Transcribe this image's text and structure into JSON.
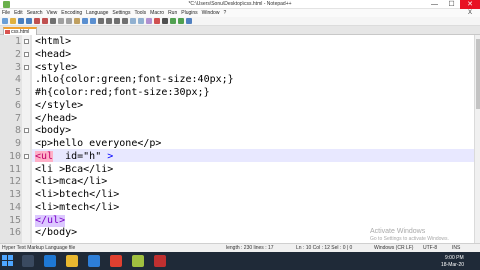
{
  "window": {
    "title": "*C:\\Users\\Sonu\\Desktop\\css.html - Notepad++",
    "controls": [
      "—",
      "☐",
      "✕"
    ]
  },
  "menu": [
    "File",
    "Edit",
    "Search",
    "View",
    "Encoding",
    "Language",
    "Settings",
    "Tools",
    "Macro",
    "Run",
    "Plugins",
    "Window",
    "?"
  ],
  "menu_close": "X",
  "tab": {
    "label": "css.html"
  },
  "editor": {
    "current_line": 10,
    "lines": [
      {
        "n": "1",
        "t": "<html>"
      },
      {
        "n": "2",
        "t": "<head>"
      },
      {
        "n": "3",
        "t": "<style>"
      },
      {
        "n": "4",
        "t": ".hlo{color:green;font-size:40px;}"
      },
      {
        "n": "5",
        "t": "#h{color:red;font-size:30px;}"
      },
      {
        "n": "6",
        "t": "</style>"
      },
      {
        "n": "7",
        "t": "</head>"
      },
      {
        "n": "8",
        "t": "<body>"
      },
      {
        "n": "9",
        "t": "<p>hello everyone</p>"
      },
      {
        "n": "10",
        "a": "<ul",
        "b": "  id=\"h\"",
        "c": " >"
      },
      {
        "n": "11",
        "t": "<li >Bca</li>"
      },
      {
        "n": "12",
        "t": "<li>mca</li>"
      },
      {
        "n": "13",
        "t": "<li>btech</li>"
      },
      {
        "n": "14",
        "t": "<li>mtech</li>"
      },
      {
        "n": "15",
        "t": "</ul>"
      },
      {
        "n": "16",
        "t": "</body>"
      }
    ]
  },
  "status": {
    "type": "Hyper Text Markup Language file",
    "length": "length : 230   lines : 17",
    "pos": "Ln : 10   Col : 12   Sel : 0 | 0",
    "eol": "Windows (CR LF)",
    "enc": "UTF-8",
    "mode": "INS"
  },
  "watermark": {
    "line1": "Activate Windows",
    "line2": "Go to Settings to activate Windows."
  },
  "tray": {
    "time": "9:00 PM",
    "date": "18-Mar-20"
  },
  "colors": {
    "accent": "#f0a030",
    "current_line": "#e8e8ff",
    "tag_highlight": "#ffb0c8",
    "ul_highlight": "#dcc8ff",
    "taskbar": "#1f2a38"
  }
}
